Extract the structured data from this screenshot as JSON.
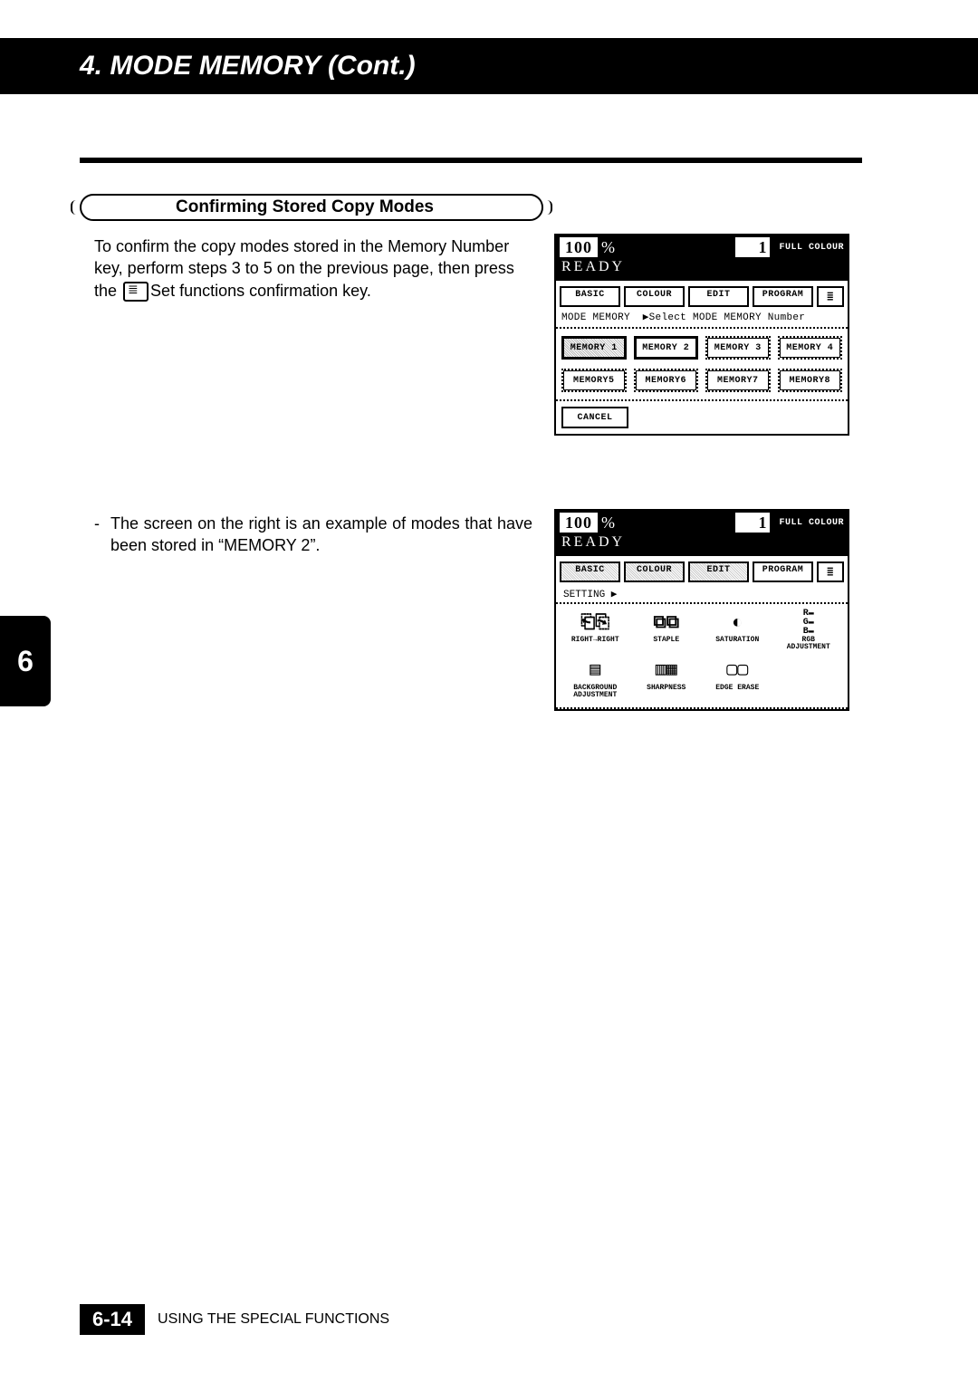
{
  "header": {
    "title": "4.  MODE  MEMORY (Cont.)"
  },
  "section": {
    "heading": "Confirming Stored Copy Modes",
    "para1_a": "To confirm the copy modes stored in the  Memory Number key, perform steps 3 to 5 on the previous page, then press the",
    "para1_b": "Set functions confirmation key.",
    "bullet1": "The screen on the right is an example of modes that have been stored in “MEMORY 2”."
  },
  "panel1": {
    "zoom": "100",
    "zoom_unit": "%",
    "copies": "1",
    "mode": "FULL COLOUR",
    "ready": "READY",
    "tabs": [
      "BASIC",
      "COLOUR",
      "EDIT",
      "PROGRAM"
    ],
    "subline_a": "MODE MEMORY",
    "subline_b": "▶Select MODE MEMORY Number",
    "mem": [
      "MEMORY 1",
      "MEMORY 2",
      "MEMORY 3",
      "MEMORY 4",
      "MEMORY5",
      "MEMORY6",
      "MEMORY7",
      "MEMORY8"
    ],
    "cancel": "CANCEL"
  },
  "panel2": {
    "zoom": "100",
    "zoom_unit": "%",
    "copies": "1",
    "mode": "FULL COLOUR",
    "ready": "READY",
    "tabs": [
      "BASIC",
      "COLOUR",
      "EDIT",
      "PROGRAM"
    ],
    "subline": "SETTING  ▶",
    "icons": [
      {
        "label": "RIGHT→RIGHT"
      },
      {
        "label": "STAPLE"
      },
      {
        "label": "SATURATION"
      },
      {
        "label": "RGB\nADJUSTMENT"
      },
      {
        "label": "BACKGROUND\nADJUSTMENT"
      },
      {
        "label": "SHARPNESS"
      },
      {
        "label": "EDGE ERASE"
      }
    ]
  },
  "sidetab": "6",
  "footer": {
    "page": "6-14",
    "label": "USING THE SPECIAL FUNCTIONS"
  }
}
